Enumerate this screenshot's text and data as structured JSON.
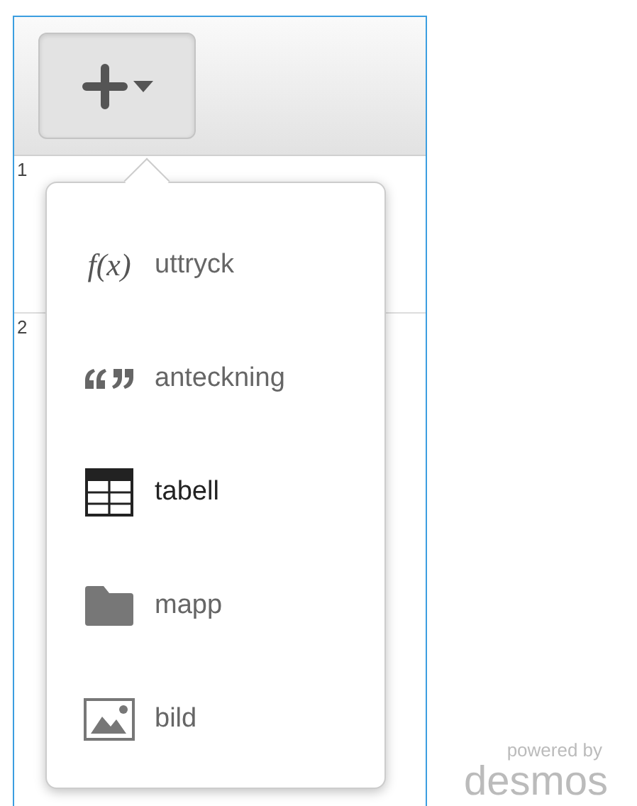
{
  "add_button": {
    "expanded": true
  },
  "rows": [
    {
      "number": "1"
    },
    {
      "number": "2"
    }
  ],
  "menu": [
    {
      "kind": "expression",
      "symbol": "f(x)",
      "label": "uttryck",
      "selected": false
    },
    {
      "kind": "note",
      "label": "anteckning",
      "selected": false
    },
    {
      "kind": "table",
      "label": "tabell",
      "selected": true
    },
    {
      "kind": "folder",
      "label": "mapp",
      "selected": false
    },
    {
      "kind": "image",
      "label": "bild",
      "selected": false
    }
  ],
  "branding": {
    "caption": "powered by",
    "logo": "desmos"
  }
}
